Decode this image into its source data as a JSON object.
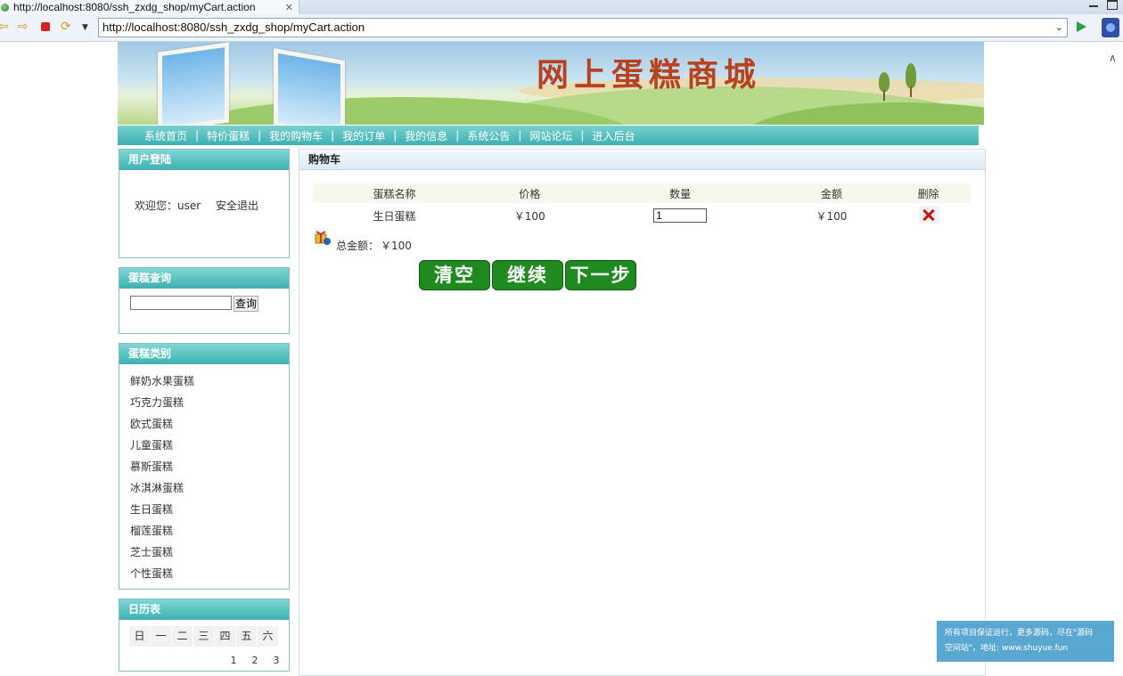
{
  "browser": {
    "tab_title": "http://localhost:8080/ssh_zxdg_shop/myCart.action",
    "tab_close": "✕",
    "url": "http://localhost:8080/ssh_zxdg_shop/myCart.action"
  },
  "site": {
    "title": "网上蛋糕商城",
    "menu": [
      "系统首页",
      "特价蛋糕",
      "我的购物车",
      "我的订单",
      "我的信息",
      "系统公告",
      "网站论坛",
      "进入后台"
    ],
    "menu_separator": "|"
  },
  "login_box": {
    "title": "用户登陆",
    "welcome": "欢迎您：user",
    "logout": "安全退出"
  },
  "search_box": {
    "title": "蛋糕查询",
    "input_value": "",
    "button": "查询"
  },
  "category_box": {
    "title": "蛋糕类别",
    "items": [
      "鲜奶水果蛋糕",
      "巧克力蛋糕",
      "欧式蛋糕",
      "儿童蛋糕",
      "慕斯蛋糕",
      "冰淇淋蛋糕",
      "生日蛋糕",
      "榴莲蛋糕",
      "芝士蛋糕",
      "个性蛋糕"
    ]
  },
  "calendar_box": {
    "title": "日历表",
    "weekdays": [
      "日",
      "一",
      "二",
      "三",
      "四",
      "五",
      "六"
    ],
    "first_row": [
      "1",
      "2",
      "3"
    ]
  },
  "cart": {
    "title": "购物车",
    "columns": [
      "蛋糕名称",
      "价格",
      "数量",
      "金额",
      "删除"
    ],
    "rows": [
      {
        "name": "生日蛋糕",
        "price": "￥100",
        "quantity": "1",
        "amount": "￥100"
      }
    ],
    "total_label": "总金额：",
    "total_value": "￥100",
    "buttons": {
      "clear": "清空",
      "continue": "继续",
      "next": "下一步"
    }
  },
  "watermark": {
    "line1": "所有项目保证运行，更多源码，尽在\"源码",
    "line2": "空间站\"，地址: www.shuyue.fun"
  },
  "colors": {
    "menu_bar": "#3cb1b1",
    "button_green": "#1f8a1f",
    "title_red": "#b8411e"
  },
  "icons": [
    "globe-icon",
    "back-icon",
    "forward-icon",
    "stop-icon",
    "refresh-icon",
    "go-icon",
    "delete-icon",
    "gift-icon"
  ]
}
